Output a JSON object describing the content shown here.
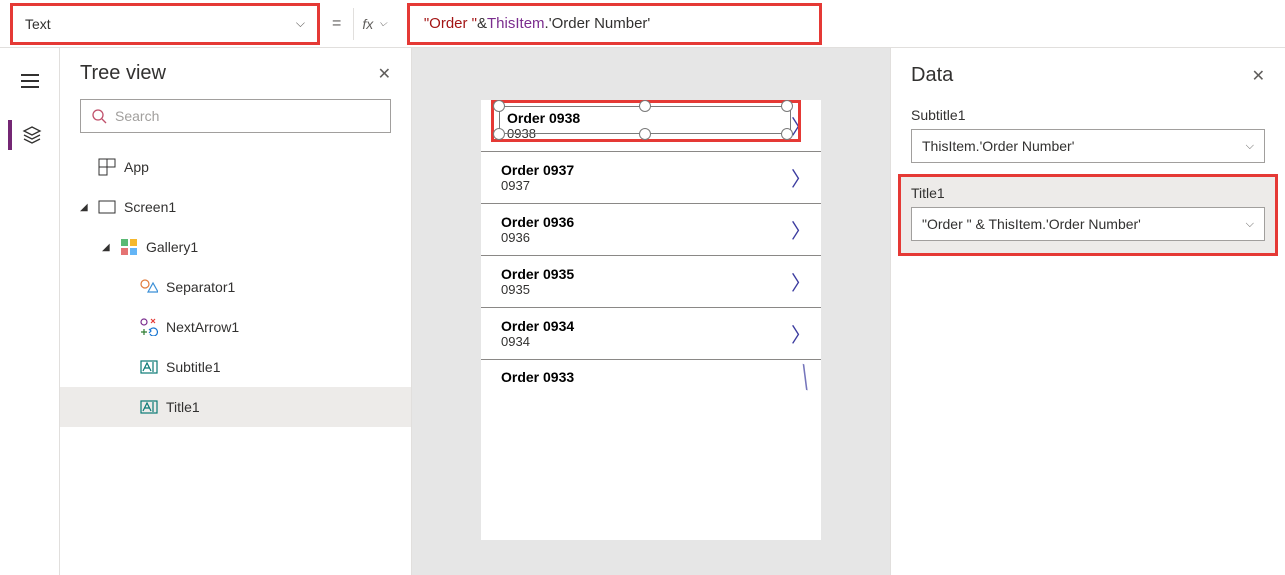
{
  "formulaBar": {
    "property": "Text",
    "equals": "=",
    "fxLabel": "fx",
    "formula": {
      "str": "\"Order \"",
      "amp": " & ",
      "obj": "ThisItem",
      "dot": ".",
      "prop": "'Order Number'"
    }
  },
  "treeView": {
    "title": "Tree view",
    "searchPlaceholder": "Search",
    "items": {
      "app": "App",
      "screen": "Screen1",
      "gallery": "Gallery1",
      "separator": "Separator1",
      "nextArrow": "NextArrow1",
      "subtitle": "Subtitle1",
      "title": "Title1"
    }
  },
  "canvas": {
    "rows": [
      {
        "title": "Order 0938",
        "subtitle": "0938"
      },
      {
        "title": "Order 0937",
        "subtitle": "0937"
      },
      {
        "title": "Order 0936",
        "subtitle": "0936"
      },
      {
        "title": "Order 0935",
        "subtitle": "0935"
      },
      {
        "title": "Order 0934",
        "subtitle": "0934"
      },
      {
        "title": "Order 0933",
        "subtitle": ""
      }
    ]
  },
  "dataPanel": {
    "title": "Data",
    "fields": [
      {
        "label": "Subtitle1",
        "value": "ThisItem.'Order Number'"
      },
      {
        "label": "Title1",
        "value": "\"Order \" & ThisItem.'Order Number'"
      }
    ]
  }
}
